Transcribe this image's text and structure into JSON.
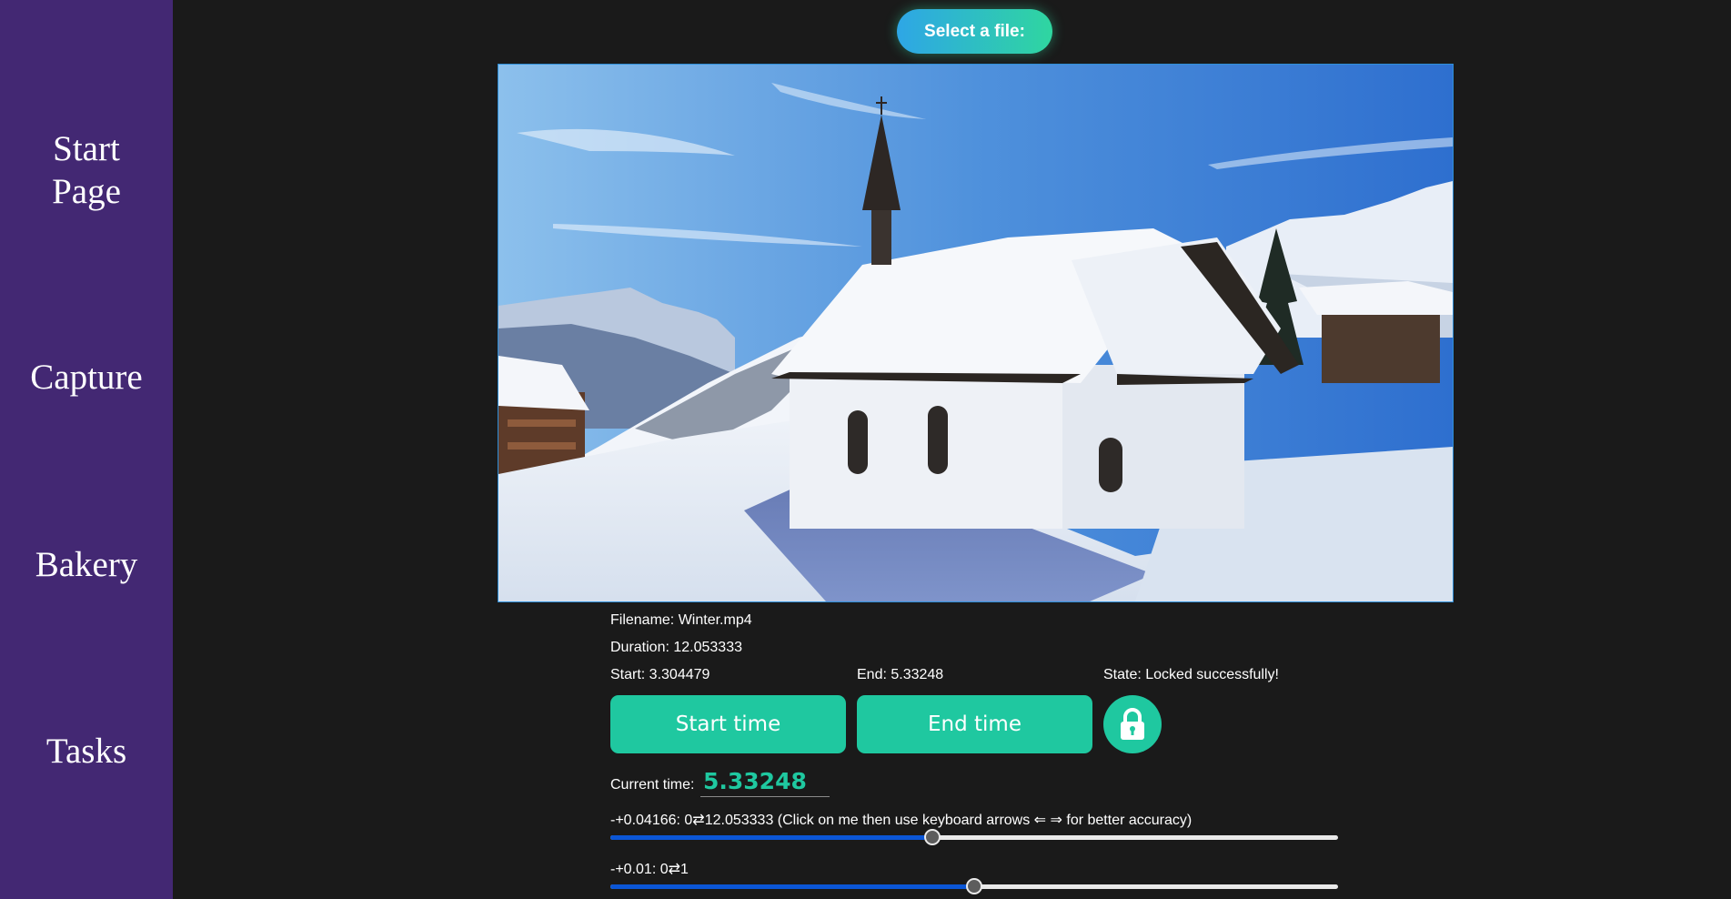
{
  "sidebar": {
    "items": [
      {
        "label_line1": "Start",
        "label_line2": "Page"
      },
      {
        "label": "Capture"
      },
      {
        "label": "Bakery"
      },
      {
        "label": "Tasks"
      }
    ]
  },
  "header": {
    "select_file_label": "Select a file:"
  },
  "video": {
    "scene_description_icon": "video-frame-winter-chapel"
  },
  "info": {
    "filename": "Filename: Winter.mp4",
    "duration": "Duration: 12.053333",
    "start": "Start: 3.304479",
    "end": "End: 5.33248",
    "state": "State: Locked successfully!"
  },
  "controls": {
    "start_time_label": "Start time",
    "end_time_label": "End time",
    "lock_icon": "lock-icon",
    "current_time_label": "Current time:",
    "current_time_value": "5.33248"
  },
  "sliders": [
    {
      "label": "-+0.04166: 0⇄12.053333 (Click on me then use keyboard arrows ⇐ ⇒ for better accuracy)",
      "min": 0,
      "max": 12.053333,
      "value": 5.33248
    },
    {
      "label": "-+0.01: 0⇄1",
      "min": 0,
      "max": 1,
      "value": 0.5
    }
  ],
  "colors": {
    "sidebar_bg": "#432873",
    "accent": "#1fc8a0",
    "slider_fill": "#0b56d6",
    "page_bg": "#1a1a1a"
  }
}
